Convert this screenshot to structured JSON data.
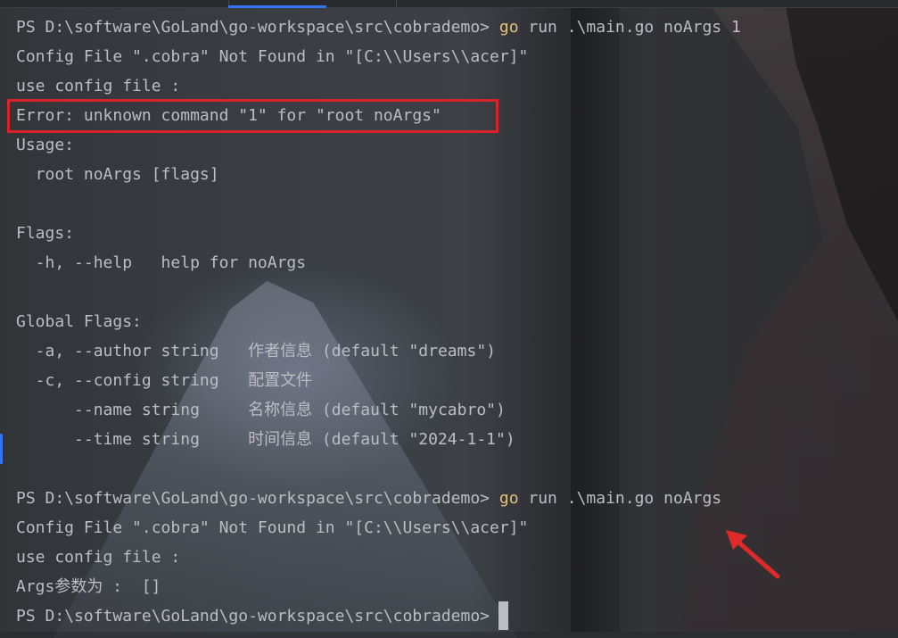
{
  "terminal": {
    "lines": [
      {
        "text": "PS D:\\software\\GoLand\\go-workspace\\src\\cobrademo> ",
        "kw": "go",
        "rest": " run .\\main.go noArgs 1"
      },
      {
        "text": "Config File \".cobra\" Not Found in \"[C:\\\\Users\\\\acer]\""
      },
      {
        "text": "use config file :"
      },
      {
        "text": "Error: unknown command \"1\" for \"root noArgs\""
      },
      {
        "text": "Usage:"
      },
      {
        "text": "  root noArgs [flags]"
      },
      {
        "text": ""
      },
      {
        "text": "Flags:"
      },
      {
        "text": "  -h, --help   help for noArgs"
      },
      {
        "text": ""
      },
      {
        "text": "Global Flags:"
      },
      {
        "text": "  -a, --author string   作者信息 (default \"dreams\")"
      },
      {
        "text": "  -c, --config string   配置文件"
      },
      {
        "text": "      --name string     名称信息 (default \"mycabro\")"
      },
      {
        "text": "      --time string     时间信息 (default \"2024-1-1\")"
      },
      {
        "text": ""
      },
      {
        "text": "PS D:\\software\\GoLand\\go-workspace\\src\\cobrademo> ",
        "kw": "go",
        "rest": " run .\\main.go noArgs"
      },
      {
        "text": "Config File \".cobra\" Not Found in \"[C:\\\\Users\\\\acer]\""
      },
      {
        "text": "use config file :"
      },
      {
        "text": "Args参数为 :  []"
      },
      {
        "text": "PS D:\\software\\GoLand\\go-workspace\\src\\cobrademo>"
      }
    ]
  },
  "colors": {
    "text": "#bcbec4",
    "keyword": "#e5c07b",
    "highlight_box": "#d8232a",
    "arrow": "#e02a2a"
  }
}
